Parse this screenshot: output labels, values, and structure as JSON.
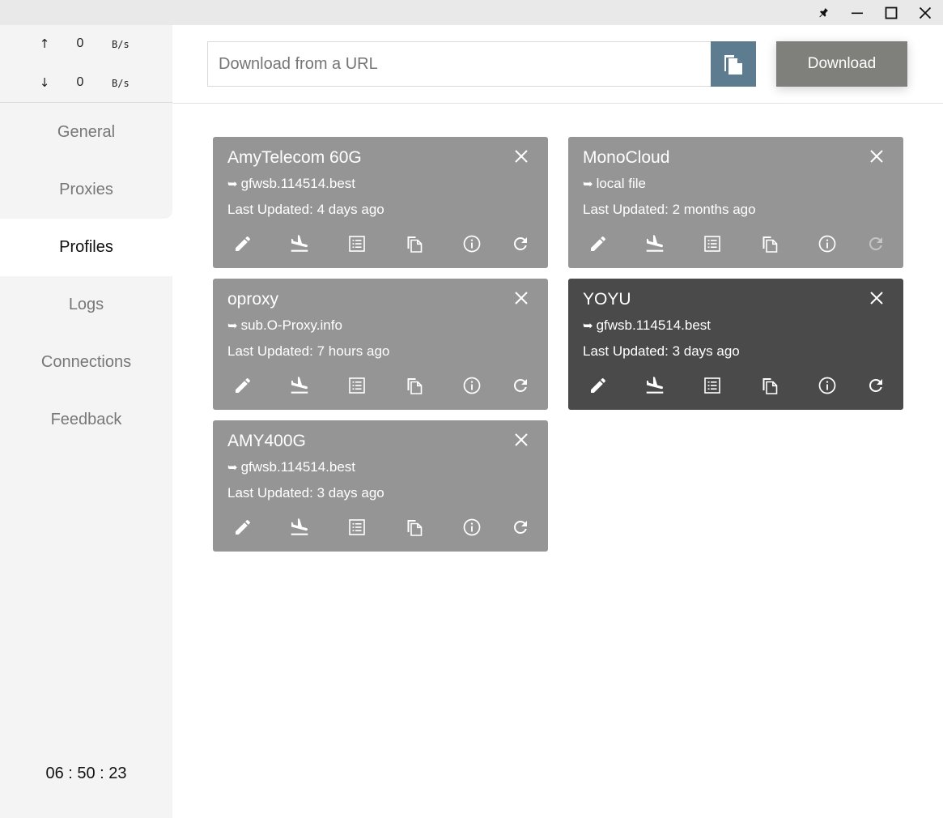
{
  "traffic": {
    "up": {
      "arrow": "↑",
      "value": "0",
      "unit": "B/s"
    },
    "down": {
      "arrow": "↓",
      "value": "0",
      "unit": "B/s"
    }
  },
  "nav": {
    "items": [
      {
        "label": "General"
      },
      {
        "label": "Proxies"
      },
      {
        "label": "Profiles",
        "active": true
      },
      {
        "label": "Logs"
      },
      {
        "label": "Connections"
      },
      {
        "label": "Feedback"
      }
    ]
  },
  "clock": "06 : 50 : 23",
  "header": {
    "url_placeholder": "Download from a URL",
    "url_value": "",
    "download_label": "Download"
  },
  "profiles": [
    {
      "name": "AmyTelecom 60G",
      "pointer": "➥",
      "source": "gfwsb.114514.best",
      "updated": "Last Updated: 4 days ago",
      "selected": false,
      "refresh_enabled": true
    },
    {
      "name": "MonoCloud",
      "pointer": "➥",
      "source": "local file",
      "updated": "Last Updated: 2 months ago",
      "selected": false,
      "refresh_enabled": false
    },
    {
      "name": "oproxy",
      "pointer": "➥",
      "source": "sub.O-Proxy.info",
      "updated": "Last Updated: 7 hours ago",
      "selected": false,
      "refresh_enabled": true
    },
    {
      "name": "YOYU",
      "pointer": "➥",
      "source": "gfwsb.114514.best",
      "updated": "Last Updated: 3 days ago",
      "selected": true,
      "refresh_enabled": true
    },
    {
      "name": "AMY400G",
      "pointer": "➥",
      "source": "gfwsb.114514.best",
      "updated": "Last Updated: 3 days ago",
      "selected": false,
      "refresh_enabled": true
    }
  ],
  "colors": {
    "card_default": "#969595",
    "card_selected": "#4a4a4a",
    "paste_button": "#5e7c8f",
    "download_button": "#7f7f7b",
    "sidebar_bg": "#f4f4f4"
  },
  "icons": {
    "window": [
      "pin-icon",
      "minimize-icon",
      "maximize-icon",
      "close-icon"
    ],
    "card_actions": [
      "edit-icon",
      "flight-land-icon",
      "list-icon",
      "copy-icon",
      "info-icon",
      "refresh-icon"
    ],
    "card_close": "close-icon",
    "paste": "paste-file-icon"
  }
}
